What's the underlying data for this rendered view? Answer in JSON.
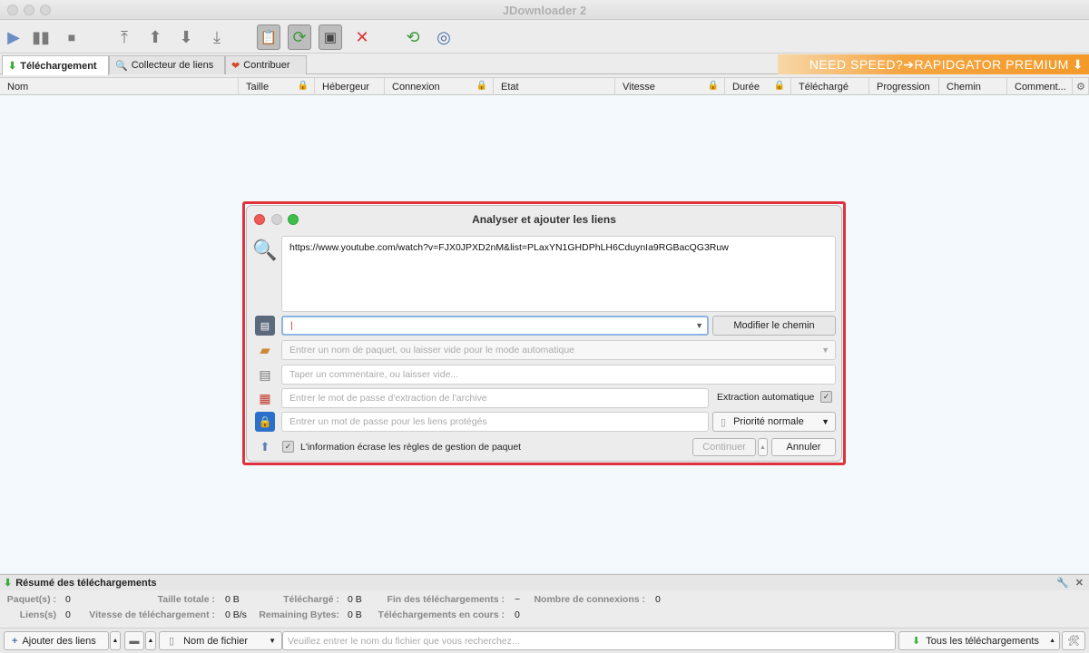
{
  "window": {
    "title": "JDownloader 2"
  },
  "tabs": [
    {
      "label": "Téléchargement"
    },
    {
      "label": "Collecteur de liens"
    },
    {
      "label": "Contribuer"
    }
  ],
  "banner": {
    "text": "NEED SPEED?➔RAPIDGATOR PREMIUM"
  },
  "columns": [
    "Nom",
    "Taille",
    "Hébergeur",
    "Connexion",
    "Etat",
    "Vitesse",
    "Durée",
    "Téléchargé",
    "Progression",
    "Chemin",
    "Comment..."
  ],
  "summary": {
    "title": "Résumé des téléchargements",
    "row1": {
      "paquets_k": "Paquet(s) :",
      "paquets_v": "0",
      "taille_k": "Taille totale :",
      "taille_v": "0 B",
      "telecharge_k": "Téléchargé :",
      "telecharge_v": "0 B",
      "fin_k": "Fin des téléchargements :",
      "fin_v": "~",
      "connexions_k": "Nombre de connexions :",
      "connexions_v": "0"
    },
    "row2": {
      "liens_k": "Liens(s)",
      "liens_v": "0",
      "vitesse_k": "Vitesse de téléchargement :",
      "vitesse_v": "0 B/s",
      "remaining_k": "Remaining Bytes:",
      "remaining_v": "0 B",
      "encours_k": "Téléchargements en cours :",
      "encours_v": "0"
    }
  },
  "bottombar": {
    "add_links": "Ajouter des liens",
    "filename_label": "Nom de fichier",
    "search_placeholder": "Veuillez entrer le nom du fichier que vous recherchez...",
    "all_downloads": "Tous les téléchargements"
  },
  "dialog": {
    "title": "Analyser et ajouter les liens",
    "url_text": "https://www.youtube.com/watch?v=FJX0JPXD2nM&list=PLaxYN1GHDPhLH6CduynIa9RGBacQG3Ruw",
    "path_value": "|",
    "change_path": "Modifier le chemin",
    "package_placeholder": "Entrer un nom de paquet, ou laisser vide pour le mode automatique",
    "comment_placeholder": "Taper un commentaire, ou laisser vide...",
    "archive_pw_placeholder": "Entrer le mot de passe d'extraction de l'archive",
    "auto_extract": "Extraction automatique",
    "links_pw_placeholder": "Entrer un mot de passe pour les liens protégés",
    "priority": "Priorité normale",
    "overwrite_label": "L'information écrase les règles de gestion de paquet",
    "continue": "Continuer",
    "cancel": "Annuler"
  },
  "colors": {
    "accent_red": "#e0323b",
    "table_bg": "#f3f9fd",
    "banner_orange": "#f39a2a"
  }
}
